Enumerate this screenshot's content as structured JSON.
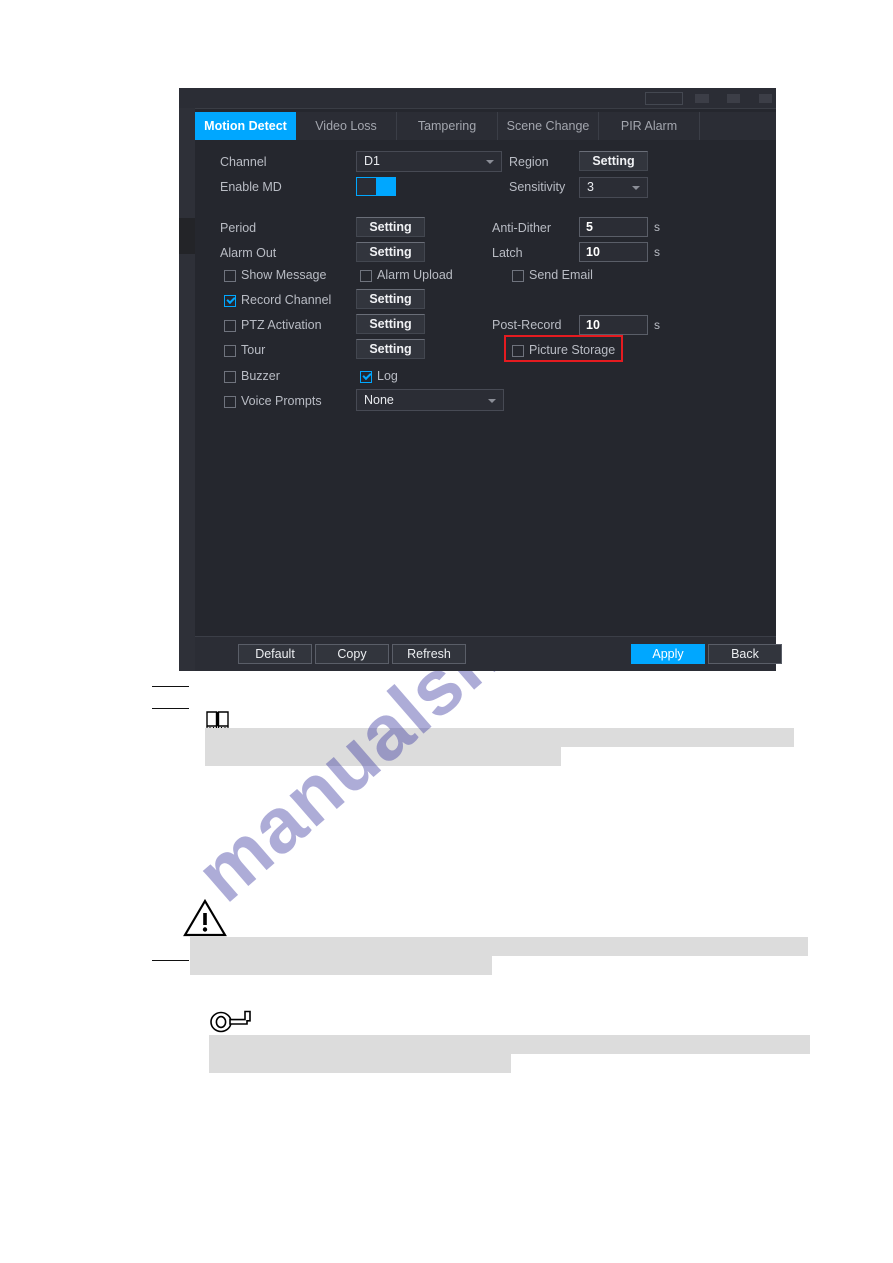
{
  "watermark": {
    "text": "manualshive.com"
  },
  "dialog": {
    "tabs": [
      {
        "label": "Motion Detect",
        "active": true
      },
      {
        "label": "Video Loss",
        "active": false
      },
      {
        "label": "Tampering",
        "active": false
      },
      {
        "label": "Scene Change",
        "active": false
      },
      {
        "label": "PIR Alarm",
        "active": false
      }
    ],
    "fields": {
      "channel_label": "Channel",
      "channel_value": "D1",
      "region_label": "Region",
      "region_button": "Setting",
      "enable_md_label": "Enable MD",
      "enable_md_state": "on",
      "sensitivity_label": "Sensitivity",
      "sensitivity_value": "3",
      "period_label": "Period",
      "period_button": "Setting",
      "anti_dither_label": "Anti-Dither",
      "anti_dither_value": "5",
      "anti_dither_unit": "s",
      "alarm_out_label": "Alarm Out",
      "alarm_out_button": "Setting",
      "latch_label": "Latch",
      "latch_value": "10",
      "latch_unit": "s",
      "show_message_label": "Show Message",
      "alarm_upload_label": "Alarm Upload",
      "send_email_label": "Send Email",
      "record_channel_label": "Record Channel",
      "record_channel_button": "Setting",
      "ptz_activation_label": "PTZ Activation",
      "ptz_activation_button": "Setting",
      "post_record_label": "Post-Record",
      "post_record_value": "10",
      "post_record_unit": "s",
      "tour_label": "Tour",
      "tour_button": "Setting",
      "picture_storage_label": "Picture Storage",
      "buzzer_label": "Buzzer",
      "log_label": "Log",
      "voice_prompts_label": "Voice Prompts",
      "voice_prompts_value": "None"
    },
    "footer": {
      "default_label": "Default",
      "copy_label": "Copy",
      "refresh_label": "Refresh",
      "apply_label": "Apply",
      "back_label": "Back"
    },
    "highlight_color": "#e51b20",
    "accent_color": "#00a7ff"
  }
}
